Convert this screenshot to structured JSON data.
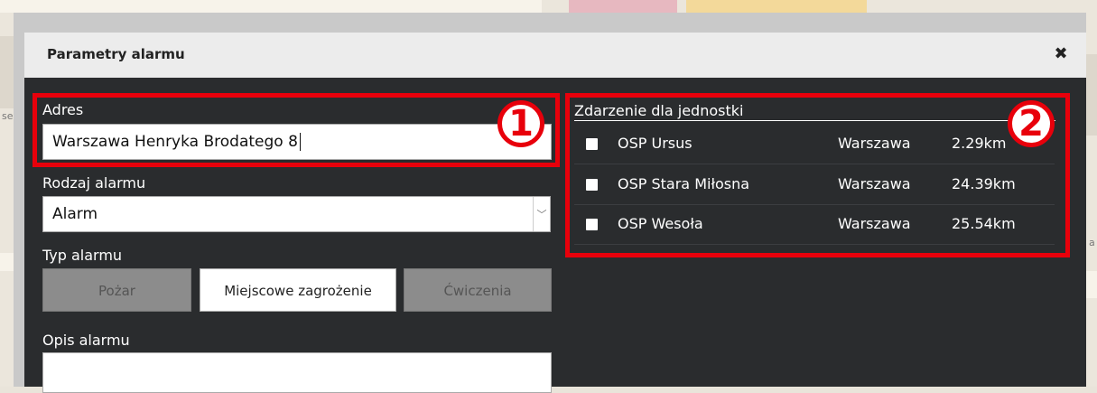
{
  "dialog": {
    "title": "Parametry alarmu",
    "close_icon": "close-icon"
  },
  "form": {
    "address_label": "Adres",
    "address_value": "Warszawa Henryka Brodatego 8",
    "alarm_kind_label": "Rodzaj alarmu",
    "alarm_kind_value": "Alarm",
    "alarm_type_label": "Typ alarmu",
    "alarm_types": [
      {
        "label": "Pożar",
        "selected": false
      },
      {
        "label": "Miejscowe zagrożenie",
        "selected": true
      },
      {
        "label": "Ćwiczenia",
        "selected": false
      }
    ],
    "description_label": "Opis alarmu",
    "description_value": ""
  },
  "units": {
    "header": "Zdarzenie dla jednostki",
    "rows": [
      {
        "name": "OSP Ursus",
        "city": "Warszawa",
        "distance": "2.29km",
        "checked": false
      },
      {
        "name": "OSP Stara Miłosna",
        "city": "Warszawa",
        "distance": "24.39km",
        "checked": false
      },
      {
        "name": "OSP Wesoła",
        "city": "Warszawa",
        "distance": "25.54km",
        "checked": false
      }
    ]
  },
  "annotations": {
    "marker_1": "1",
    "marker_2": "2",
    "color": "#e8000b"
  },
  "map": {
    "label_left": "se",
    "label_right": "a"
  }
}
